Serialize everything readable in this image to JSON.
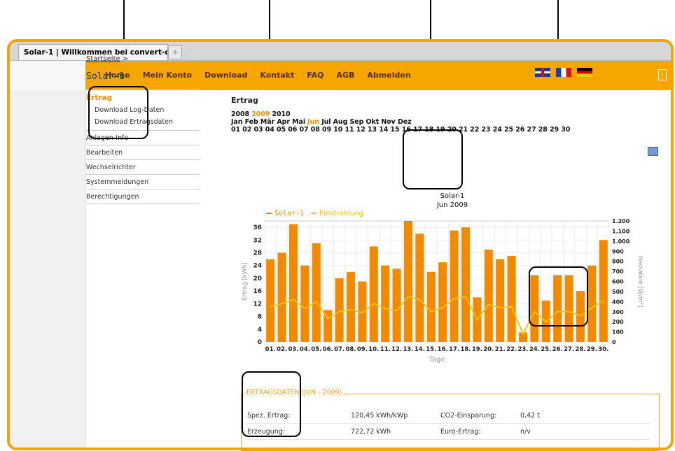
{
  "tab": {
    "title": "Solar-1 | Willkommen bei convert-c...",
    "new_tab": "+"
  },
  "nav": {
    "items": [
      "Home",
      "Mein Konto",
      "Download",
      "Kontakt",
      "FAQ",
      "AGB",
      "Abmelden"
    ]
  },
  "flags": [
    "flag-uk-icon",
    "flag-fr-icon",
    "flag-de-icon"
  ],
  "sidebar": {
    "breadcrumb": "Startseite",
    "breadcrumb_sep": ">",
    "title": "Solar-1",
    "active": "Ertrag",
    "submenu": [
      "Download Log-Daten",
      "Download Ertragsdaten"
    ],
    "items": [
      "Anlagen-Info",
      "Bearbeiten",
      "Wechselrichter",
      "Systemmeldungen",
      "Berechtigungen"
    ]
  },
  "content": {
    "heading": "Ertrag",
    "years": [
      "2008",
      "2009",
      "2010"
    ],
    "selected_year": "2009",
    "months": [
      "Jan",
      "Feb",
      "Mär",
      "Apr",
      "Mai",
      "Jun",
      "Jul",
      "Aug",
      "Sep",
      "Okt",
      "Nov",
      "Dez"
    ],
    "selected_month": "Jun",
    "days": [
      "01",
      "02",
      "03",
      "04",
      "05",
      "06",
      "07",
      "08",
      "09",
      "10",
      "11",
      "12",
      "13",
      "14",
      "15",
      "16",
      "17",
      "18",
      "19",
      "20",
      "21",
      "22",
      "23",
      "24",
      "25",
      "26",
      "27",
      "28",
      "29",
      "30"
    ]
  },
  "chart_data": {
    "type": "bar",
    "title": "Solar-1",
    "subtitle": "Jun 2009",
    "xlabel": "Tage",
    "ylabel": "Ertrag [kWh]",
    "y2label": "Insolation [W/m²]",
    "legend": [
      "Solar-1",
      "Einstrahlung"
    ],
    "categories": [
      "01.",
      "02.",
      "03.",
      "04.",
      "05.",
      "06.",
      "07.",
      "08.",
      "09.",
      "10.",
      "11.",
      "12.",
      "13.",
      "14.",
      "15.",
      "16.",
      "17.",
      "18.",
      "19.",
      "20.",
      "21.",
      "22.",
      "23.",
      "24.",
      "25.",
      "26.",
      "27.",
      "28.",
      "29.",
      "30."
    ],
    "series": [
      {
        "name": "Solar-1",
        "axis": "left",
        "values": [
          26,
          28,
          37,
          24,
          31,
          10,
          20,
          22,
          19,
          30,
          24,
          23,
          38,
          34,
          22,
          25,
          35,
          36,
          14,
          29,
          26,
          27,
          3,
          21,
          13,
          21,
          21,
          16,
          24,
          32
        ]
      },
      {
        "name": "Einstrahlung",
        "axis": "right",
        "type": "line",
        "values": [
          350,
          380,
          420,
          330,
          400,
          230,
          300,
          320,
          290,
          380,
          330,
          310,
          450,
          420,
          300,
          340,
          430,
          450,
          220,
          370,
          340,
          350,
          80,
          300,
          200,
          300,
          300,
          260,
          340,
          410
        ]
      }
    ],
    "ylim": [
      0,
      38
    ],
    "y_ticks": [
      0,
      4,
      8,
      12,
      16,
      20,
      24,
      28,
      32,
      36
    ],
    "y2lim": [
      0,
      1200
    ],
    "y2_ticks": [
      0,
      100,
      200,
      300,
      400,
      500,
      600,
      700,
      800,
      900,
      1000,
      1100,
      1200
    ],
    "colors": {
      "bars": "#f28a00",
      "line": "#f5c400"
    }
  },
  "datatable": {
    "title": "ERTRAGSDATEN (JUN - 2009)",
    "rows": [
      {
        "label": "Spez. Ertrag:",
        "value": "120,45 kWh/kWp",
        "label2": "CO2-Einsparung:",
        "value2": "0,42 t"
      },
      {
        "label": "Erzeugung:",
        "value": "722,72 kWh",
        "label2": "Euro-Ertrag:",
        "value2": "n/v"
      }
    ]
  }
}
